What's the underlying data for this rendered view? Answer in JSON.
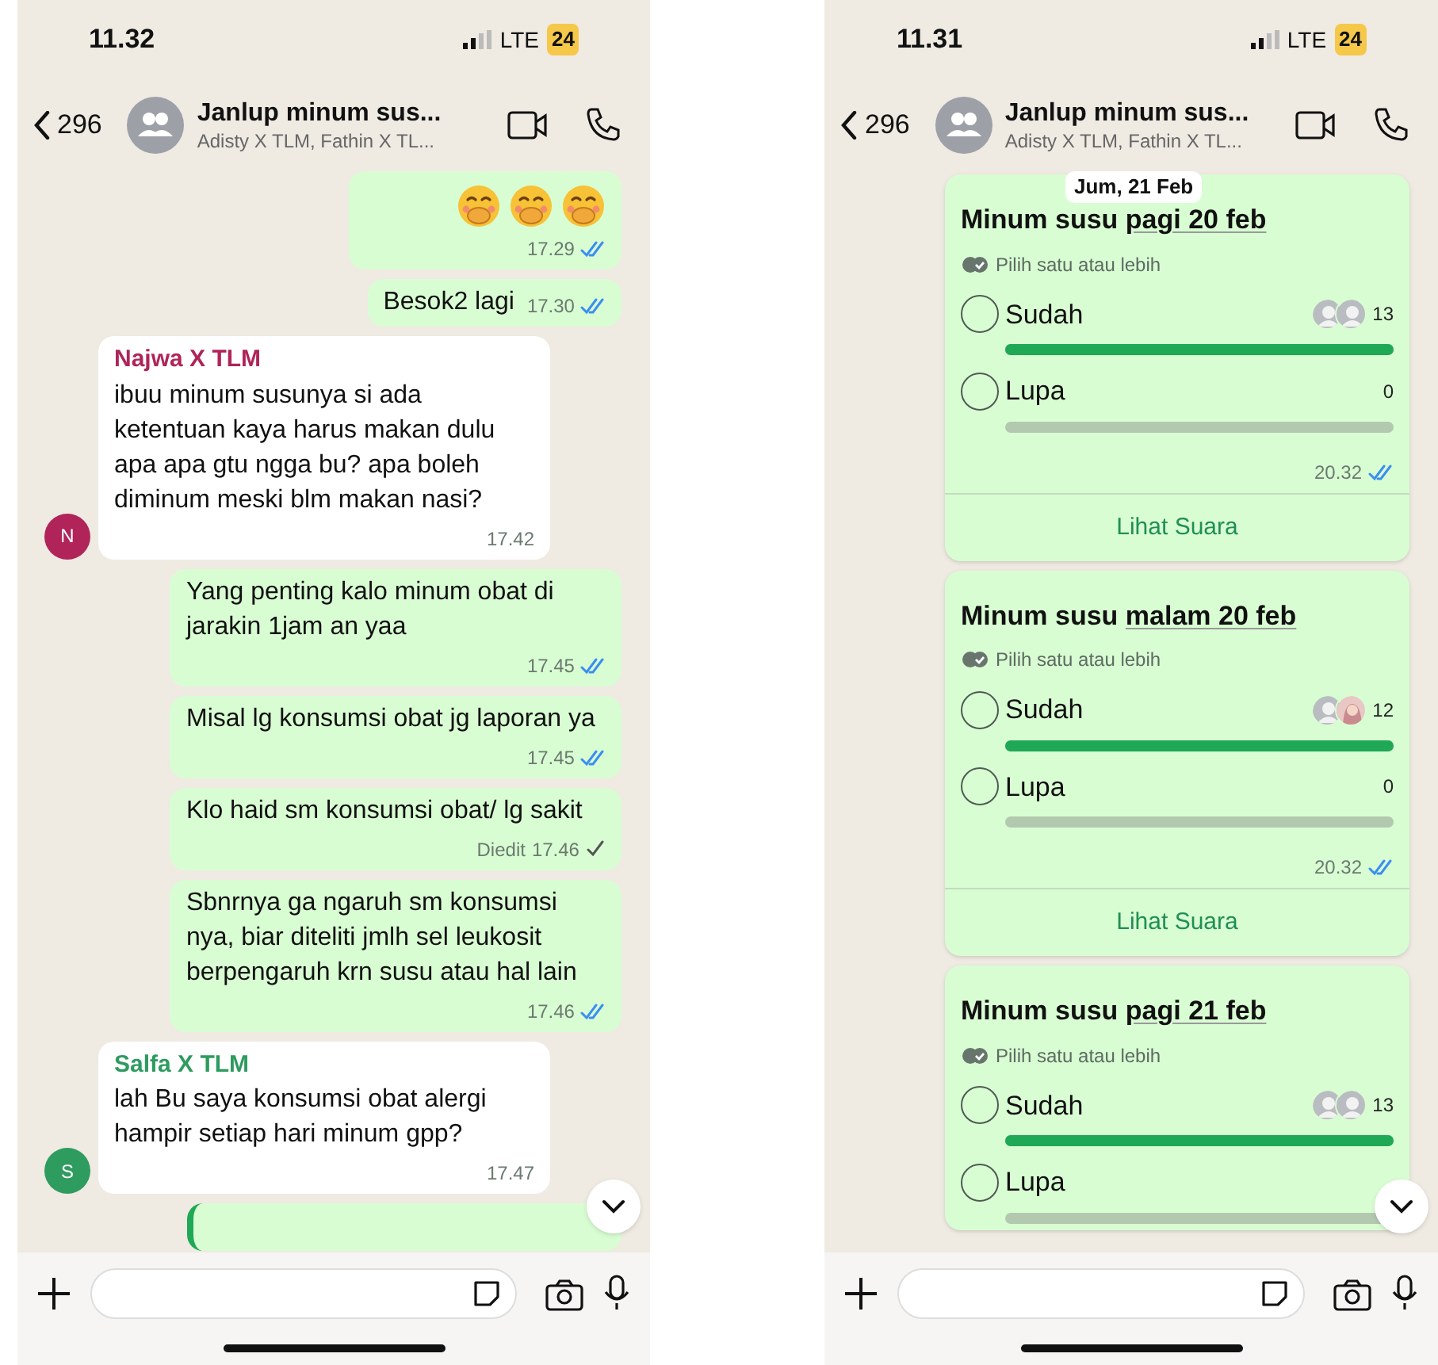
{
  "screens": [
    {
      "status_bar": {
        "time": "11.32",
        "network": "LTE",
        "battery": "24"
      },
      "header": {
        "back_count": "296",
        "title": "Janlup minum sus...",
        "subtitle": "Adisty X TLM, Fathin X TL..."
      },
      "messages": [
        {
          "kind": "emoji",
          "outgoing": true,
          "time": "17.29",
          "read": true
        },
        {
          "kind": "text",
          "outgoing": true,
          "text": "Besok2 lagi",
          "time": "17.30",
          "read": true
        },
        {
          "kind": "text",
          "outgoing": false,
          "sender": "Najwa X TLM",
          "color": "#b0245a",
          "avatar": "N",
          "text": "ibuu minum susunya si ada ketentuan kaya harus makan dulu apa apa gtu ngga bu? apa boleh diminum meski blm makan nasi?",
          "time": "17.42"
        },
        {
          "kind": "text",
          "outgoing": true,
          "text": "Yang penting kalo minum obat di jarakin 1jam an yaa",
          "time": "17.45",
          "read": true
        },
        {
          "kind": "text",
          "outgoing": true,
          "text": "Misal lg konsumsi obat jg laporan ya",
          "time": "17.45",
          "read": true
        },
        {
          "kind": "text",
          "outgoing": true,
          "text": "Klo haid sm konsumsi obat/ lg sakit",
          "edited_label": "Diedit",
          "time": "17.46",
          "read": false
        },
        {
          "kind": "text",
          "outgoing": true,
          "text": "Sbnrnya ga ngaruh sm konsumsi nya, biar diteliti jmlh sel leukosit berpengaruh krn susu atau hal lain",
          "time": "17.46",
          "read": true
        },
        {
          "kind": "text",
          "outgoing": false,
          "sender": "Salfa X TLM",
          "color": "#2e9b5f",
          "avatar": "S",
          "text": "lah Bu saya konsumsi obat alergi hampir setiap hari minum gpp?",
          "time": "17.47"
        },
        {
          "kind": "cut_off",
          "outgoing": true
        }
      ]
    },
    {
      "status_bar": {
        "time": "11.31",
        "network": "LTE",
        "battery": "24"
      },
      "header": {
        "back_count": "296",
        "title": "Janlup minum sus...",
        "subtitle": "Adisty X TLM, Fathin X TL..."
      },
      "date_pill": "Jum, 21 Feb",
      "messages": [
        {
          "kind": "poll",
          "outgoing": true,
          "title_parts": [
            {
              "text": "Minum susu ",
              "underlined": false
            },
            {
              "text": "pagi 20 feb",
              "underlined": true
            }
          ],
          "hint": "Pilih satu atau lebih",
          "options": [
            {
              "label": "Sudah",
              "selected": false,
              "level": 1,
              "count": "13",
              "voters": [
                {
                  "kind": "silhouette"
                },
                {
                  "kind": "silhouette"
                }
              ]
            },
            {
              "label": "Lupa",
              "selected": false,
              "level": 0,
              "count": "0"
            }
          ],
          "time": "20.32",
          "read": true,
          "action": "Lihat Suara"
        },
        {
          "kind": "poll",
          "outgoing": true,
          "title_parts": [
            {
              "text": "Minum susu ",
              "underlined": false
            },
            {
              "text": "malam 20 feb",
              "underlined": true
            }
          ],
          "hint": "Pilih satu atau lebih",
          "options": [
            {
              "label": "Sudah",
              "selected": false,
              "level": 1,
              "count": "12",
              "voters": [
                {
                  "kind": "silhouette"
                },
                {
                  "kind": "photo"
                }
              ]
            },
            {
              "label": "Lupa",
              "selected": false,
              "level": 0,
              "count": "0"
            }
          ],
          "time": "20.32",
          "read": true,
          "action": "Lihat Suara"
        },
        {
          "kind": "poll",
          "outgoing": true,
          "title_parts": [
            {
              "text": "Minum susu ",
              "underlined": false
            },
            {
              "text": "pagi 21 feb",
              "underlined": true
            }
          ],
          "hint": "Pilih satu atau lebih",
          "options": [
            {
              "label": "Sudah",
              "selected": false,
              "level": 1,
              "count": "13",
              "voters": [
                {
                  "kind": "silhouette"
                },
                {
                  "kind": "silhouette"
                }
              ]
            },
            {
              "label": "Lupa",
              "selected": false,
              "level": 0
            }
          ]
        }
      ]
    }
  ]
}
